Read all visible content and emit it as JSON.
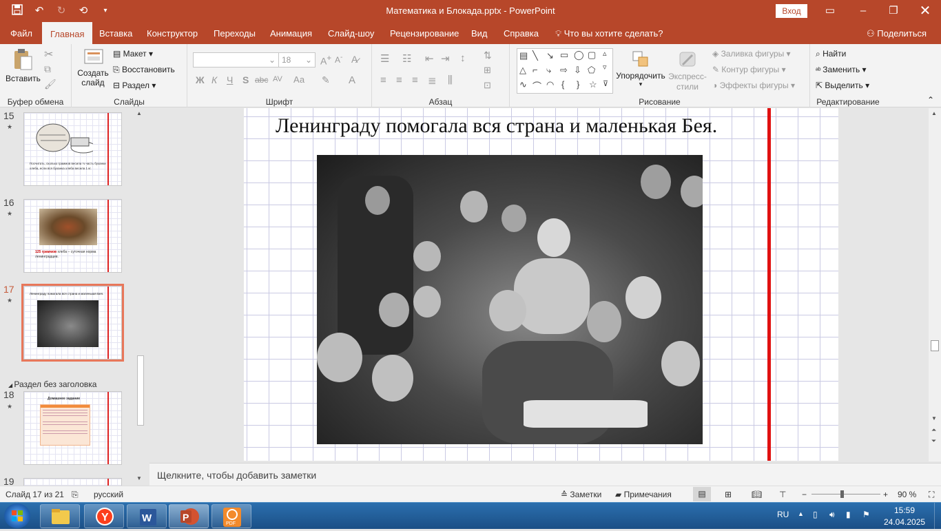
{
  "app": {
    "window_title": "Математика и Блокада.pptx  -  PowerPoint",
    "login_label": "Вход"
  },
  "qat": {
    "icons": [
      "save-icon",
      "undo-icon",
      "redo-icon",
      "present-from-start-icon",
      "customize-qat-icon"
    ]
  },
  "tabs": [
    "Файл",
    "Главная",
    "Вставка",
    "Конструктор",
    "Переходы",
    "Анимация",
    "Слайд-шоу",
    "Рецензирование",
    "Вид",
    "Справка"
  ],
  "tell_me": "Что вы хотите сделать?",
  "share_label": "Поделиться",
  "ribbon": {
    "clipboard": {
      "paste": "Вставить",
      "label": "Буфер обмена"
    },
    "slides": {
      "new_slide": "Создать слайд",
      "layout": "Макет",
      "reset": "Восстановить",
      "section": "Раздел",
      "label": "Слайды"
    },
    "font": {
      "size": "18",
      "label": "Шрифт",
      "bold": "Ж",
      "italic": "К",
      "underline": "Ч",
      "shadow": "S",
      "strike": "abc",
      "spacing": "AV",
      "case": "Аа",
      "color": "A"
    },
    "paragraph": {
      "label": "Абзац"
    },
    "drawing": {
      "arrange": "Упорядочить",
      "quick_styles": "Экспресс-стили",
      "fill": "Заливка фигуры",
      "outline": "Контур фигуры",
      "effects": "Эффекты фигуры",
      "label": "Рисование"
    },
    "editing": {
      "find": "Найти",
      "replace": "Заменить",
      "select": "Выделить",
      "label": "Редактирование"
    }
  },
  "thumbnails": [
    {
      "number": "15",
      "text": "Посчитать, сколько граммов весила ⅛ часть буханки хлеба, если вся буханка хлеба весила 1 кг."
    },
    {
      "number": "16",
      "highlight": "125 граммов",
      "text": " хлеба – суточная норма ленинградцев."
    },
    {
      "number": "17",
      "text": "Ленинграду помогала вся страна и маленькая Бея."
    },
    {
      "number": "18",
      "text": "Домашнее задание"
    },
    {
      "number": "19",
      "text": ""
    }
  ],
  "section_name": "Раздел без заголовка",
  "slide": {
    "title": "Ленинграду помогала вся страна и маленькая Бея."
  },
  "notes_placeholder": "Щелкните, чтобы добавить заметки",
  "status": {
    "slide_info": "Слайд 17 из 21",
    "language": "русский",
    "notes_label": "Заметки",
    "comments_label": "Примечания",
    "zoom": "90 %"
  },
  "taskbar": {
    "apps": [
      "explorer-icon",
      "yandex-browser-icon",
      "word-icon",
      "powerpoint-icon",
      "pdf-icon"
    ],
    "lang": "RU",
    "time": "15:59",
    "date": "24.04.2025"
  },
  "colors": {
    "accent": "#b7472a",
    "ribbon_bg": "#f3f3f3",
    "slide_red_line": "#e01010",
    "taskbar": "#1f5c97"
  }
}
